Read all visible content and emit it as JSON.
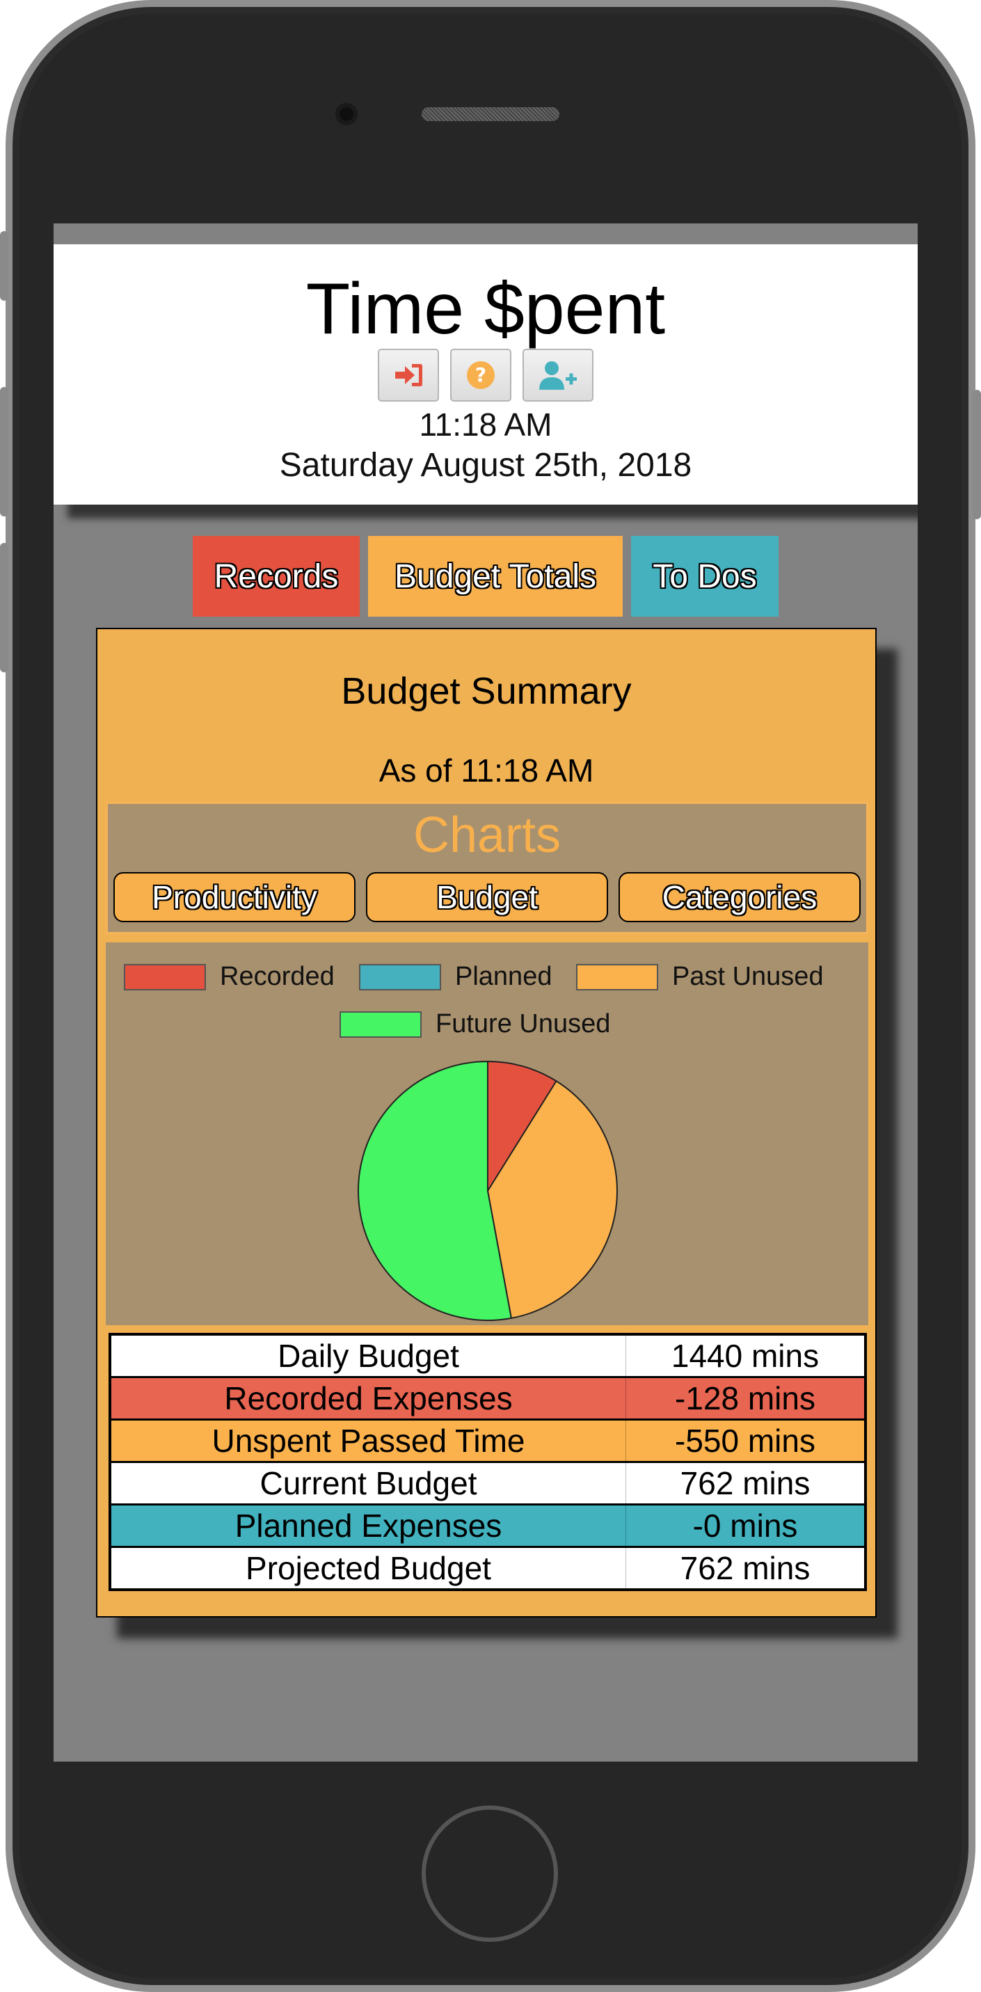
{
  "app": {
    "title": "Time $pent",
    "time": "11:18 AM",
    "date": "Saturday August 25th, 2018"
  },
  "header_icons": [
    {
      "name": "sign-in-icon",
      "color": "#e4523f"
    },
    {
      "name": "help-icon",
      "color": "#f8b04d"
    },
    {
      "name": "add-user-icon",
      "color": "#45b1bf"
    }
  ],
  "tabs": [
    {
      "label": "Records",
      "color": "#e4523f"
    },
    {
      "label": "Budget Totals",
      "color": "#f8b04d"
    },
    {
      "label": "To Dos",
      "color": "#45b1bf"
    }
  ],
  "summary": {
    "title": "Budget Summary",
    "as_of": "As of 11:18 AM"
  },
  "charts": {
    "title": "Charts",
    "buttons": [
      "Productivity",
      "Budget",
      "Categories"
    ]
  },
  "chart_data": {
    "type": "pie",
    "labels": [
      "Recorded",
      "Planned",
      "Past Unused",
      "Future Unused"
    ],
    "values": [
      128,
      0,
      550,
      762
    ],
    "colors": [
      "#e4523f",
      "#45b1bf",
      "#fbb24c",
      "#45f563"
    ],
    "legend": "top"
  },
  "table": {
    "rows": [
      {
        "label": "Daily Budget",
        "value": "1440 mins"
      },
      {
        "label": "Recorded Expenses",
        "value": "-128 mins"
      },
      {
        "label": "Unspent Passed Time",
        "value": "-550 mins"
      },
      {
        "label": "Current Budget",
        "value": "762 mins"
      },
      {
        "label": "Planned Expenses",
        "value": "-0 mins"
      },
      {
        "label": "Projected Budget",
        "value": "762 mins"
      }
    ]
  }
}
